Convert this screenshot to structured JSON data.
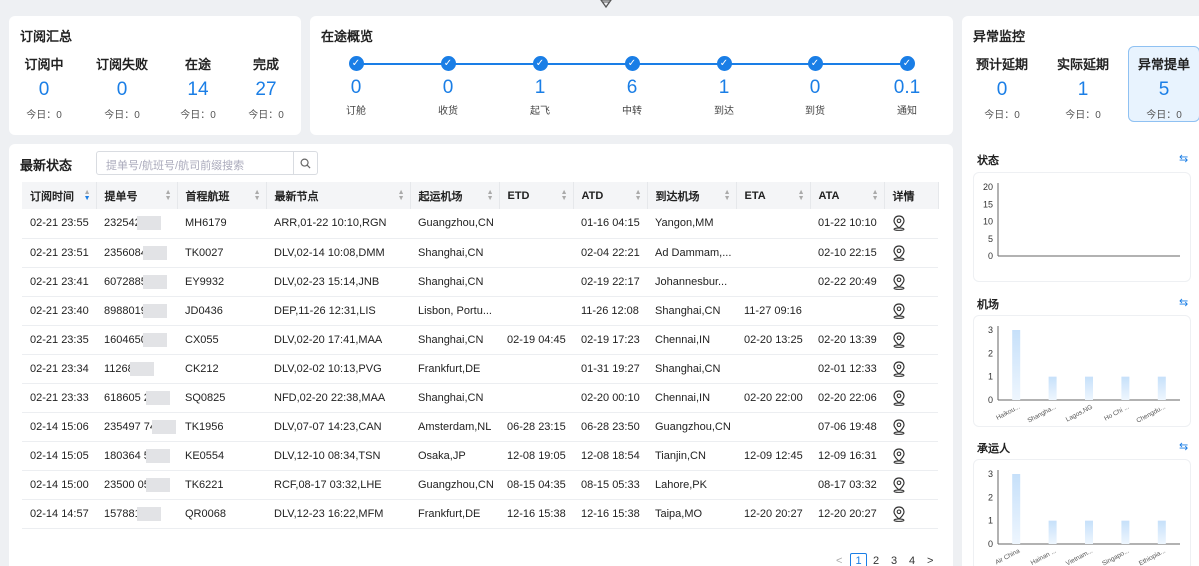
{
  "subscription": {
    "title": "订阅汇总",
    "stats": [
      {
        "label": "订阅中",
        "value": "0",
        "sub": "今日：0"
      },
      {
        "label": "订阅失败",
        "value": "0",
        "sub": "今日：0"
      },
      {
        "label": "在途",
        "value": "14",
        "sub": "今日：0"
      },
      {
        "label": "完成",
        "value": "27",
        "sub": "今日：0"
      }
    ]
  },
  "transit": {
    "title": "在途概览",
    "steps": [
      {
        "label": "订舱",
        "value": "0"
      },
      {
        "label": "收货",
        "value": "0"
      },
      {
        "label": "起飞",
        "value": "1"
      },
      {
        "label": "中转",
        "value": "6"
      },
      {
        "label": "到达",
        "value": "1"
      },
      {
        "label": "到货",
        "value": "0"
      },
      {
        "label": "通知",
        "value": "0.1"
      }
    ]
  },
  "anomaly": {
    "title": "异常监控",
    "stats": [
      {
        "label": "预计延期",
        "value": "0",
        "sub": "今日：0"
      },
      {
        "label": "实际延期",
        "value": "1",
        "sub": "今日：0"
      },
      {
        "label": "异常提单",
        "value": "5",
        "sub": "今日：0"
      }
    ]
  },
  "latest": {
    "title": "最新状态",
    "search_placeholder": "提单号/航班号/航司前缀搜索",
    "columns": [
      "订阅时间",
      "提单号",
      "首程航班",
      "最新节点",
      "起运机场",
      "ETD",
      "ATD",
      "到达机场",
      "ETA",
      "ATA",
      "详情"
    ],
    "rows": [
      [
        "02-21 23:55",
        "232542",
        "MH6179",
        "ARR,01-22 10:10,RGN",
        "Guangzhou,CN",
        "",
        "01-16 04:15",
        "Yangon,MM",
        "",
        "01-22 10:10"
      ],
      [
        "02-21 23:51",
        "2356084",
        "TK0027",
        "DLV,02-14 10:08,DMM",
        "Shanghai,CN",
        "",
        "02-04 22:21",
        "Ad Dammam,...",
        "",
        "02-10 22:15"
      ],
      [
        "02-21 23:41",
        "6072885",
        "EY9932",
        "DLV,02-23 15:14,JNB",
        "Shanghai,CN",
        "",
        "02-19 22:17",
        "Johannesbur...",
        "",
        "02-22 20:49"
      ],
      [
        "02-21 23:40",
        "8988019",
        "JD0436",
        "DEP,11-26 12:31,LIS",
        "Lisbon, Portu...",
        "",
        "11-26 12:08",
        "Shanghai,CN",
        "11-27 09:16",
        ""
      ],
      [
        "02-21 23:35",
        "1604650",
        "CX055",
        "DLV,02-20 17:41,MAA",
        "Shanghai,CN",
        "02-19 04:45",
        "02-19 17:23",
        "Chennai,IN",
        "02-20 13:25",
        "02-20 13:39"
      ],
      [
        "02-21 23:34",
        "11268",
        "CK212",
        "DLV,02-02 10:13,PVG",
        "Frankfurt,DE",
        "",
        "01-31 19:27",
        "Shanghai,CN",
        "",
        "02-01 12:33"
      ],
      [
        "02-21 23:33",
        "618605 2",
        "SQ0825",
        "NFD,02-20 22:38,MAA",
        "Shanghai,CN",
        "",
        "02-20 00:10",
        "Chennai,IN",
        "02-20 22:00",
        "02-20 22:06"
      ],
      [
        "02-14 15:06",
        "235497 74",
        "TK1956",
        "DLV,07-07 14:23,CAN",
        "Amsterdam,NL",
        "06-28 23:15",
        "06-28 23:50",
        "Guangzhou,CN",
        "",
        "07-06 19:48"
      ],
      [
        "02-14 15:05",
        "180364 5",
        "KE0554",
        "DLV,12-10 08:34,TSN",
        "Osaka,JP",
        "12-08 19:05",
        "12-08 18:54",
        "Tianjin,CN",
        "12-09 12:45",
        "12-09 16:31"
      ],
      [
        "02-14 15:00",
        "23500 05",
        "TK6221",
        "RCF,08-17 03:32,LHE",
        "Guangzhou,CN",
        "08-15 04:35",
        "08-15 05:33",
        "Lahore,PK",
        "",
        "08-17 03:32"
      ],
      [
        "02-14 14:57",
        "157881",
        "QR0068",
        "DLV,12-23 16:22,MFM",
        "Frankfurt,DE",
        "12-16 15:38",
        "12-16 15:38",
        "Taipa,MO",
        "12-20 20:27",
        "12-20 20:27"
      ]
    ],
    "pager": {
      "prev": "<",
      "pages": [
        "1",
        "2",
        "3",
        "4"
      ],
      "next": ">"
    }
  },
  "colors": {
    "accent": "#1a7ee6",
    "bar": "#cfe5fb"
  },
  "chart_data": [
    {
      "type": "bar",
      "title": "状态",
      "categories": [],
      "values": [],
      "ylim": [
        0,
        20
      ],
      "yticks": [
        "0",
        "5",
        "10",
        "15",
        "20"
      ],
      "toggle": "⇆"
    },
    {
      "type": "bar",
      "title": "机场",
      "categories": [
        "Haikou...",
        "Shangha...",
        "Lagos,NG",
        "Ho Chi ...",
        "Chengdu..."
      ],
      "values": [
        3,
        1,
        1,
        1,
        1
      ],
      "ylim": [
        0,
        3
      ],
      "yticks": [
        "0",
        "1",
        "2",
        "3"
      ],
      "toggle": "⇆"
    },
    {
      "type": "bar",
      "title": "承运人",
      "categories": [
        "Air China",
        "Hainan ...",
        "Vietnam...",
        "Singapo...",
        "Ethiopia..."
      ],
      "values": [
        3,
        1,
        1,
        1,
        1
      ],
      "ylim": [
        0,
        3
      ],
      "yticks": [
        "0",
        "1",
        "2",
        "3"
      ],
      "toggle": "⇆"
    }
  ]
}
